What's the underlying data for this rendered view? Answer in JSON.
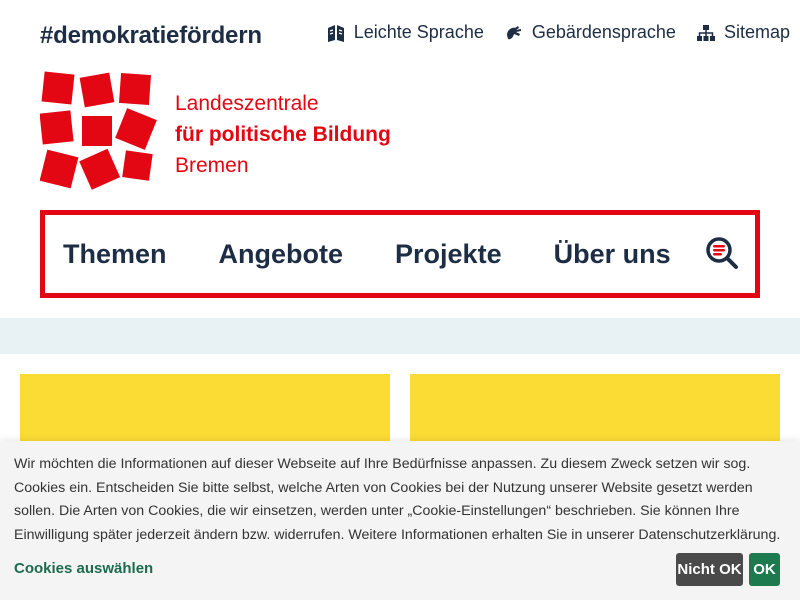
{
  "header": {
    "hashtag": "#demokratiefördern",
    "links": [
      {
        "label": "Leichte Sprache",
        "icon": "book-icon"
      },
      {
        "label": "Gebärdensprache",
        "icon": "sign-language-icon"
      },
      {
        "label": "Sitemap",
        "icon": "sitemap-icon"
      }
    ]
  },
  "logo": {
    "line1": "Landeszentrale",
    "line2": "für politische Bildung",
    "line3": "Bremen",
    "color": "#e30613"
  },
  "nav": {
    "items": [
      "Themen",
      "Angebote",
      "Projekte",
      "Über uns"
    ],
    "search_icon": "search-icon",
    "border_color": "#e30613"
  },
  "cookie": {
    "text": "Wir möchten die Informationen auf dieser Webseite auf Ihre Bedürfnisse anpassen. Zu diesem Zweck setzen wir sog. Cookies ein. Entscheiden Sie bitte selbst, welche Arten von Cookies bei der Nutzung unserer Website gesetzt werden sollen. Die Arten von Cookies, die wir einsetzen, werden unter „Cookie-Einstellungen“ beschrieben. Sie können Ihre Einwilligung später jederzeit ändern bzw. widerrufen. Weitere Informationen erhalten Sie in unserer Datenschutzerklärung.",
    "select_label": "Cookies auswählen",
    "decline_label": "Nicht OK",
    "accept_label": "OK"
  },
  "colors": {
    "text": "#1d2d44",
    "accent_red": "#e30613",
    "tile_yellow": "#fbdc35",
    "ok_green": "#1d7a4f"
  }
}
